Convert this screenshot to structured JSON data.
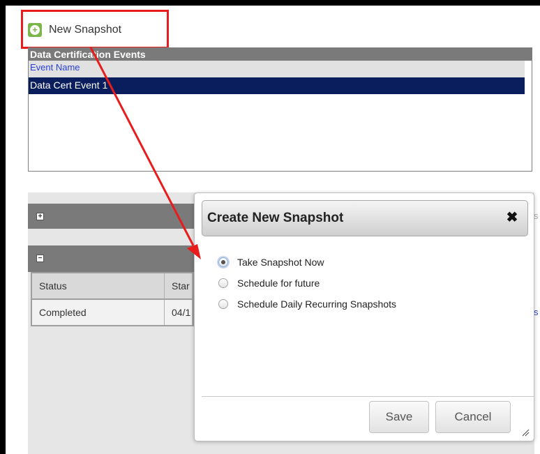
{
  "toolbar": {
    "new_snapshot_label": "New Snapshot",
    "new_snapshot_icon": "plus-circle-icon"
  },
  "events_panel": {
    "title": "Data Certification Events",
    "column_header": "Event Name",
    "rows": [
      "Data Cert Event 1"
    ]
  },
  "snapshots_table": {
    "columns": [
      "Status",
      "Star"
    ],
    "rows": [
      [
        "Completed",
        "04/1"
      ]
    ],
    "expand_toggle": "+",
    "collapse_toggle": "−",
    "edge_text": "s",
    "edge_link": "s"
  },
  "modal": {
    "title": "Create New Snapshot",
    "close_icon": "close-icon",
    "options": [
      {
        "label": "Take Snapshot Now",
        "checked": true
      },
      {
        "label": "Schedule for future",
        "checked": false
      },
      {
        "label": "Schedule Daily Recurring Snapshots",
        "checked": false
      }
    ],
    "save_label": "Save",
    "cancel_label": "Cancel"
  },
  "colors": {
    "highlight": "#e81c1c",
    "accent_green": "#7ab648",
    "selected_row": "#0a1d5c"
  }
}
